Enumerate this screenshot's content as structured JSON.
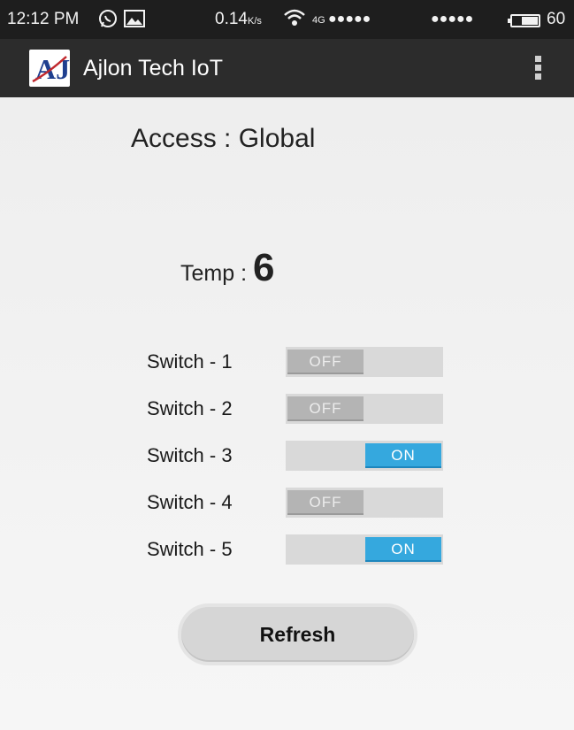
{
  "status_bar": {
    "time": "12:12 PM",
    "speed": "0.14",
    "speed_unit": "K/s",
    "network": "4G",
    "signal_dots_1": "●●●●●",
    "signal_dots_2": "●●●●●",
    "battery_level": "60",
    "icons": [
      "whatsapp-icon",
      "image-icon",
      "wifi-icon",
      "battery-icon"
    ]
  },
  "app_bar": {
    "logo_text": "AJ",
    "title": "Ajlon Tech IoT",
    "menu_icon": "overflow-menu-icon"
  },
  "main": {
    "access_text": "Access : Global",
    "temp_label": "Temp : ",
    "temp_value": "6",
    "switches": [
      {
        "label": "Switch - 1",
        "state": "OFF"
      },
      {
        "label": "Switch - 2",
        "state": "OFF"
      },
      {
        "label": "Switch - 3",
        "state": "ON"
      },
      {
        "label": "Switch - 4",
        "state": "OFF"
      },
      {
        "label": "Switch - 5",
        "state": "ON"
      }
    ],
    "refresh_label": "Refresh"
  },
  "colors": {
    "toggle_on": "#35a8de",
    "toggle_off": "#b4b4b4",
    "app_bar": "#2c2c2c",
    "status_bar": "#1e1e1e"
  }
}
